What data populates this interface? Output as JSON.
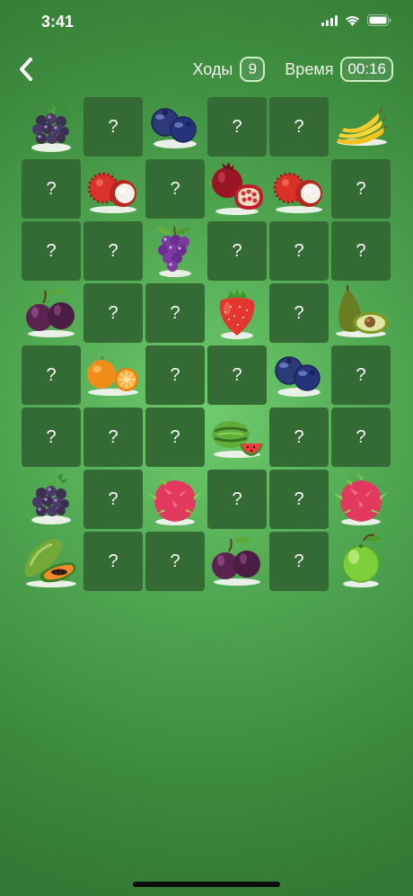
{
  "status": {
    "time": "3:41"
  },
  "header": {
    "moves_label": "Ходы",
    "moves_value": "9",
    "time_label": "Время",
    "time_value": "00:16"
  },
  "board": {
    "question_mark": "?",
    "cards": [
      {
        "state": "revealed",
        "fruit": "blackberry"
      },
      {
        "state": "hidden"
      },
      {
        "state": "revealed",
        "fruit": "blueberry"
      },
      {
        "state": "hidden"
      },
      {
        "state": "hidden"
      },
      {
        "state": "revealed",
        "fruit": "banana"
      },
      {
        "state": "hidden"
      },
      {
        "state": "revealed",
        "fruit": "rambutan"
      },
      {
        "state": "hidden"
      },
      {
        "state": "revealed",
        "fruit": "pomegranate"
      },
      {
        "state": "revealed",
        "fruit": "rambutan"
      },
      {
        "state": "hidden"
      },
      {
        "state": "hidden"
      },
      {
        "state": "hidden"
      },
      {
        "state": "revealed",
        "fruit": "grapes"
      },
      {
        "state": "hidden"
      },
      {
        "state": "hidden"
      },
      {
        "state": "hidden"
      },
      {
        "state": "revealed",
        "fruit": "plum"
      },
      {
        "state": "hidden"
      },
      {
        "state": "hidden"
      },
      {
        "state": "revealed",
        "fruit": "strawberry"
      },
      {
        "state": "hidden"
      },
      {
        "state": "revealed",
        "fruit": "avocado"
      },
      {
        "state": "hidden"
      },
      {
        "state": "revealed",
        "fruit": "orange"
      },
      {
        "state": "hidden"
      },
      {
        "state": "hidden"
      },
      {
        "state": "revealed",
        "fruit": "blueberry"
      },
      {
        "state": "hidden"
      },
      {
        "state": "hidden"
      },
      {
        "state": "hidden"
      },
      {
        "state": "hidden"
      },
      {
        "state": "revealed",
        "fruit": "watermelon"
      },
      {
        "state": "hidden"
      },
      {
        "state": "hidden"
      },
      {
        "state": "revealed",
        "fruit": "blackberry"
      },
      {
        "state": "hidden"
      },
      {
        "state": "revealed",
        "fruit": "dragonfruit"
      },
      {
        "state": "hidden"
      },
      {
        "state": "hidden"
      },
      {
        "state": "revealed",
        "fruit": "dragonfruit"
      },
      {
        "state": "revealed",
        "fruit": "papaya"
      },
      {
        "state": "hidden"
      },
      {
        "state": "hidden"
      },
      {
        "state": "revealed",
        "fruit": "plum"
      },
      {
        "state": "hidden"
      },
      {
        "state": "revealed",
        "fruit": "guava"
      }
    ]
  },
  "colors": {
    "card_back": "#346b35",
    "bg_light": "#6fcc6d",
    "bg_dark": "#347a36",
    "badge_border": "#cfeec6"
  }
}
